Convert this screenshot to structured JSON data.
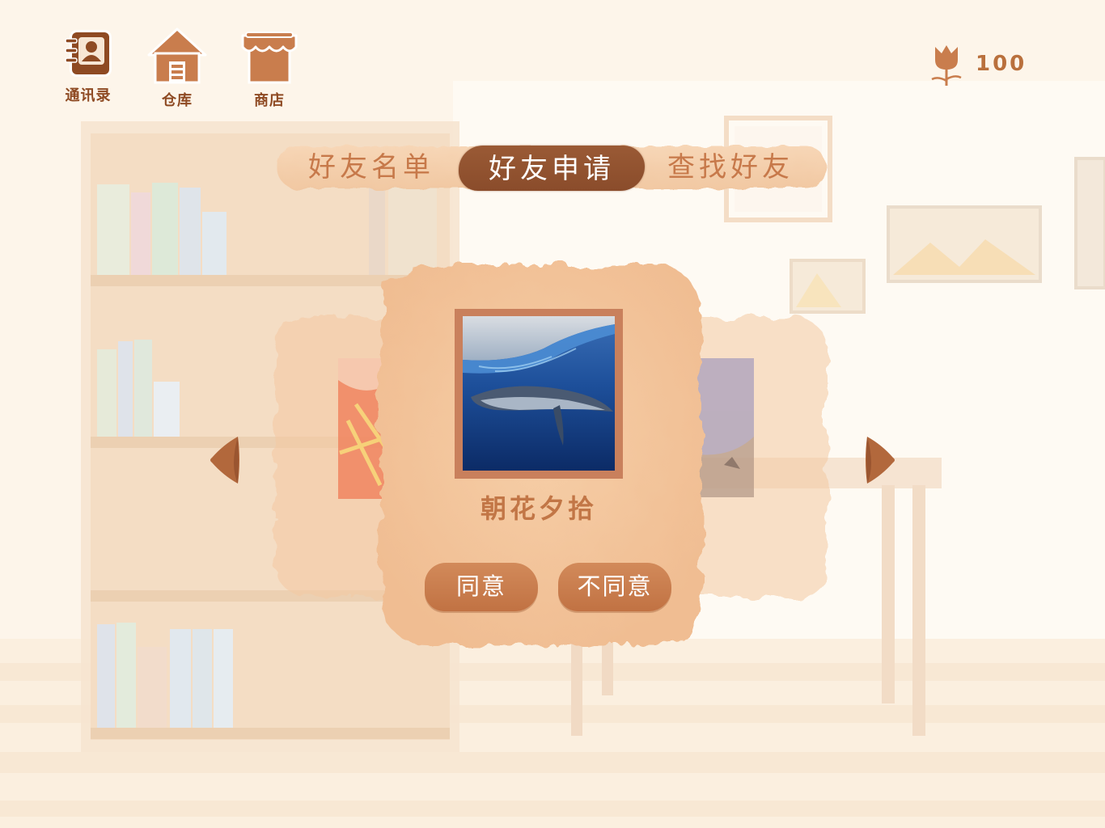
{
  "nav": {
    "items": [
      {
        "label": "通讯录",
        "icon": "contacts-book-icon"
      },
      {
        "label": "仓库",
        "icon": "warehouse-house-icon"
      },
      {
        "label": "商店",
        "icon": "shop-awning-icon"
      }
    ]
  },
  "currency": {
    "icon": "flower-icon",
    "value": "100"
  },
  "tabs": [
    {
      "label": "好友名单",
      "selected": false
    },
    {
      "label": "好友申请",
      "selected": true
    },
    {
      "label": "查找好友",
      "selected": false
    }
  ],
  "request_card": {
    "name": "朝花夕拾",
    "avatar": "whale-underwater-photo",
    "accept_label": "同意",
    "decline_label": "不同意"
  },
  "carousel": {
    "prev_icon": "chevron-left-icon",
    "next_icon": "chevron-right-icon"
  },
  "colors": {
    "accent": "#c17243",
    "dark_accent": "#8a4c2b",
    "background": "#fdf6ec",
    "card": "#f2c49a"
  }
}
